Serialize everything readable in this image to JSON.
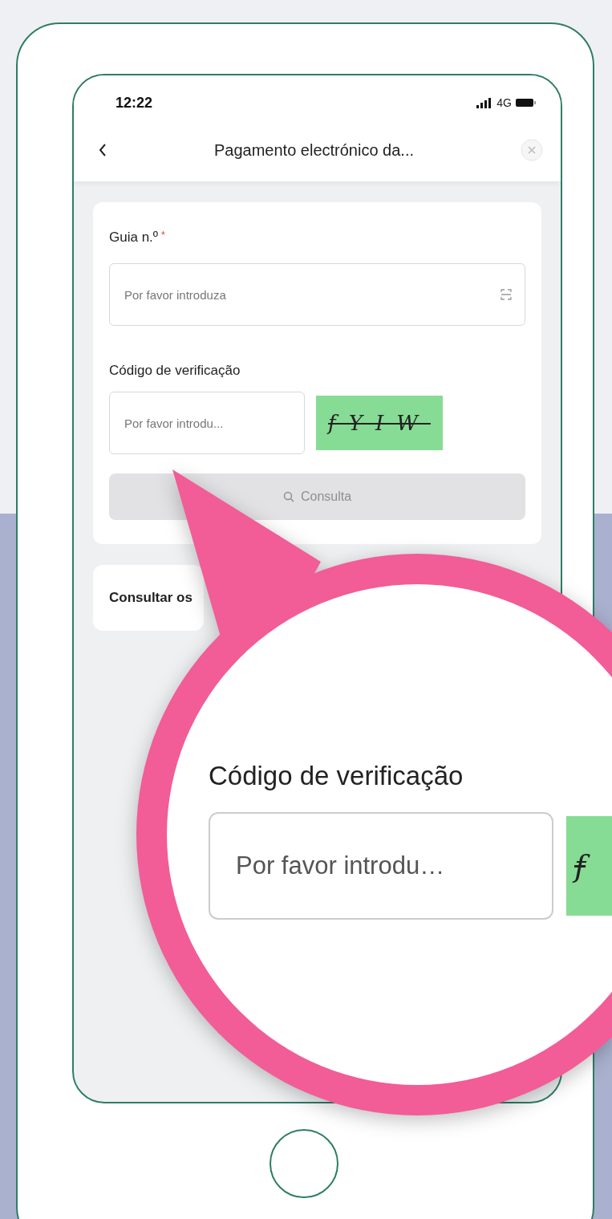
{
  "status_bar": {
    "time": "12:22",
    "network": "4G"
  },
  "header": {
    "title": "Pagamento electrónico da..."
  },
  "form": {
    "fields": [
      {
        "label": "Guia n.º",
        "required_mark": "*",
        "placeholder": "Por favor introduza",
        "kind": "scan"
      },
      {
        "label": "Código de verificação",
        "placeholder": "Por favor introdu...",
        "kind": "captcha",
        "captcha": "fYIW"
      }
    ],
    "button": {
      "label": "Consulta",
      "disabled": true
    }
  },
  "second_card": {
    "title": "Consultar os"
  },
  "magnifier": {
    "label": "Código de verificação",
    "placeholder": "Por favor introdu…",
    "captcha": "f"
  }
}
